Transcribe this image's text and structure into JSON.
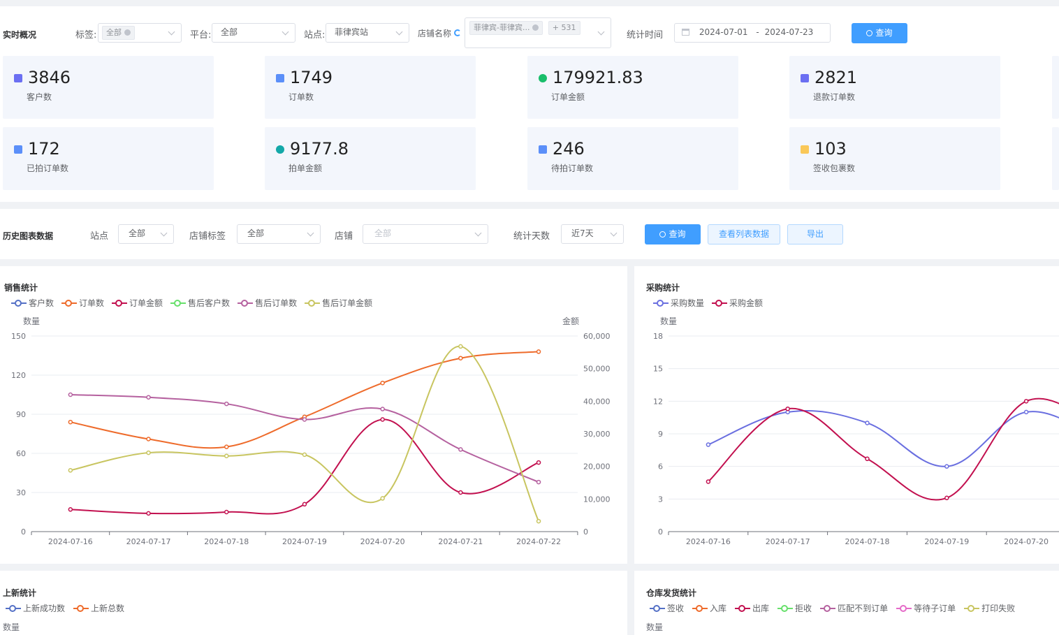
{
  "top_filter": {
    "title": "实时概况",
    "tag_label": "标签:",
    "tag_value": "全部",
    "platform_label": "平台:",
    "platform_value": "全部",
    "site_label": "站点:",
    "site_value": "菲律宾站",
    "shop_label": "店铺名称",
    "shop_tag": "菲律宾-菲律宾...",
    "shop_more": "+ 531",
    "stat_time_label": "统计时间",
    "date_start": "2024-07-01",
    "date_sep": "-",
    "date_end": "2024-07-23",
    "query_label": "查询"
  },
  "cards": [
    {
      "value": "3846",
      "label": "客户数",
      "color": "#6b6ff2"
    },
    {
      "value": "1749",
      "label": "订单数",
      "color": "#5b8ff9"
    },
    {
      "value": "179921.83",
      "label": "订单金额",
      "color": "#19be6b"
    },
    {
      "value": "2821",
      "label": "退款订单数",
      "color": "#6b6ff2"
    },
    {
      "value": "172",
      "label": "已拍订单数",
      "color": "#5b8ff9"
    },
    {
      "value": "9177.8",
      "label": "拍单金额",
      "color": "#13a8a8"
    },
    {
      "value": "246",
      "label": "待拍订单数",
      "color": "#5b8ff9"
    },
    {
      "value": "103",
      "label": "签收包裹数",
      "color": "#fac858"
    }
  ],
  "history_filter": {
    "title": "历史图表数据",
    "site_label": "站点",
    "site_value": "全部",
    "shop_tag_label": "店铺标签",
    "shop_tag_value": "全部",
    "shop_label": "店铺",
    "shop_value": "全部",
    "days_label": "统计天数",
    "days_value": "近7天",
    "query_label": "查询",
    "list_label": "查看列表数据",
    "export_label": "导出"
  },
  "chart_data": [
    {
      "type": "line",
      "title": "销售统计",
      "ylabel": "数量",
      "y2label": "金额",
      "ylim": [
        0,
        150
      ],
      "y2lim": [
        0,
        60000
      ],
      "yticks": [
        "0",
        "30",
        "60",
        "90",
        "120",
        "150"
      ],
      "y2ticks": [
        "0",
        "10,000",
        "20,000",
        "30,000",
        "40,000",
        "50,000",
        "60,000"
      ],
      "categories": [
        "2024-07-16",
        "2024-07-17",
        "2024-07-18",
        "2024-07-19",
        "2024-07-20",
        "2024-07-21",
        "2024-07-22"
      ],
      "series": [
        {
          "name": "客户数",
          "color": "#5470c6",
          "axis": "left",
          "values": []
        },
        {
          "name": "订单数",
          "color": "#ee6b2b",
          "axis": "left",
          "values": [
            84,
            71,
            65,
            88,
            114,
            133,
            138
          ]
        },
        {
          "name": "订单金额",
          "color": "#c2104f",
          "axis": "right",
          "values": [
            6800,
            5600,
            6000,
            8400,
            34400,
            12000,
            21200
          ]
        },
        {
          "name": "售后客户数",
          "color": "#67e06b",
          "axis": "left",
          "values": []
        },
        {
          "name": "售后订单数",
          "color": "#b5619f",
          "axis": "left",
          "values": [
            105,
            103,
            98,
            86,
            94,
            63,
            38
          ]
        },
        {
          "name": "售后订单金额",
          "color": "#c8c560",
          "axis": "right",
          "values": [
            18800,
            24200,
            23200,
            23600,
            10200,
            56800,
            3200
          ]
        }
      ]
    },
    {
      "type": "line",
      "title": "采购统计",
      "ylabel": "数量",
      "ylim": [
        0,
        18
      ],
      "yticks": [
        "0",
        "3",
        "6",
        "9",
        "12",
        "15",
        "18"
      ],
      "categories": [
        "2024-07-16",
        "2024-07-17",
        "2024-07-18",
        "2024-07-19",
        "2024-07-20"
      ],
      "series": [
        {
          "name": "采购数量",
          "color": "#6a6fe0",
          "values": [
            8,
            11,
            10,
            6,
            11
          ]
        },
        {
          "name": "采购金额",
          "color": "#c2104f",
          "values": [
            4.6,
            11.3,
            6.7,
            3.1,
            12
          ]
        }
      ]
    }
  ],
  "new_listing": {
    "title": "上新统计",
    "legend": [
      {
        "name": "上新成功数",
        "color": "#5470c6"
      },
      {
        "name": "上新总数",
        "color": "#ee6b2b"
      }
    ],
    "ylabel": "数量"
  },
  "warehouse": {
    "title": "仓库发货统计",
    "legend": [
      {
        "name": "签收",
        "color": "#5470c6"
      },
      {
        "name": "入库",
        "color": "#ee6b2b"
      },
      {
        "name": "出库",
        "color": "#c2104f"
      },
      {
        "name": "拒收",
        "color": "#67e06b"
      },
      {
        "name": "匹配不到订单",
        "color": "#b5619f"
      },
      {
        "name": "等待子订单",
        "color": "#e56ac8"
      },
      {
        "name": "打印失败",
        "color": "#c8c560"
      }
    ],
    "ylabel": "数量"
  }
}
